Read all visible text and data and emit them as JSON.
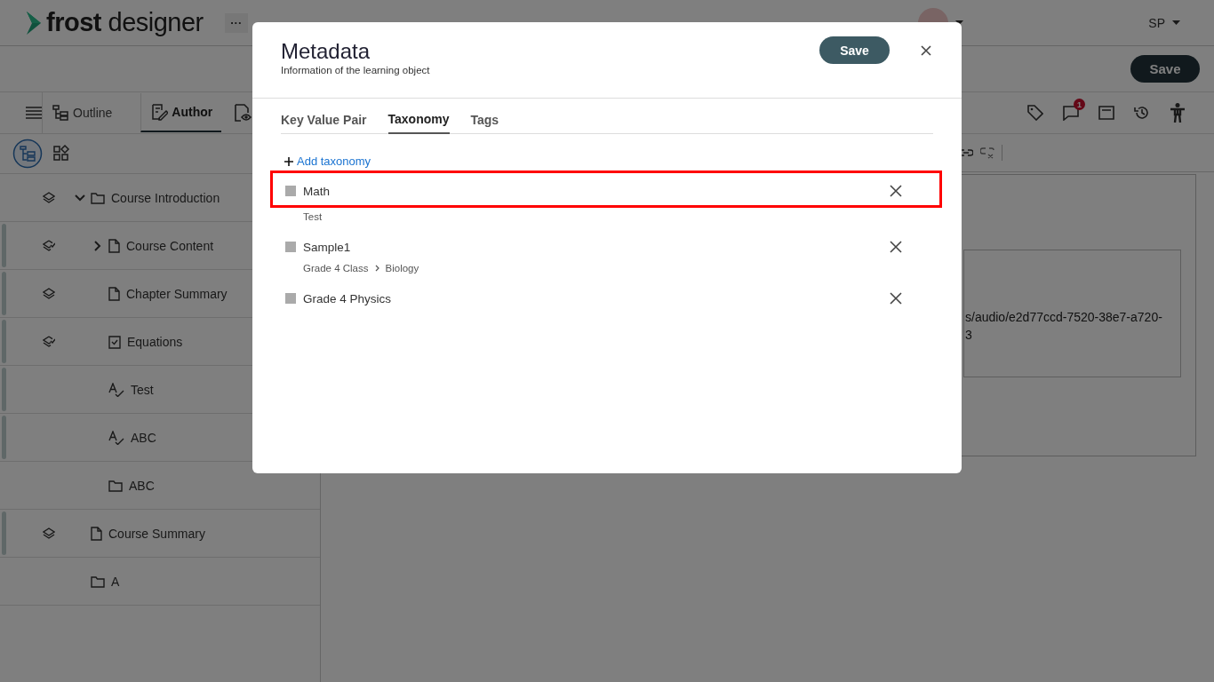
{
  "header": {
    "logo": "**frost** designer",
    "more": "···",
    "user": "SP"
  },
  "toolbar": {
    "save": "Save"
  },
  "view_tabs": [
    {
      "label": "Outline",
      "selected": false
    },
    {
      "label": "Author",
      "selected": true
    }
  ],
  "tree_modes": [
    {
      "kind": "tree",
      "selected": true
    },
    {
      "kind": "blocks",
      "selected": false
    }
  ],
  "tools": {
    "comment_badge": "1"
  },
  "tree": [
    {
      "label": "Course Introduction",
      "kind": "folder",
      "layered": true,
      "approved": false,
      "flagged": false,
      "expanded": true,
      "children": [
        {
          "label": "Course Content",
          "kind": "page",
          "layered": true,
          "approved": true,
          "flagged": true,
          "expanded": false
        },
        {
          "label": "Chapter Summary",
          "kind": "page",
          "layered": true,
          "approved": false,
          "flagged": true
        },
        {
          "label": "Equations",
          "kind": "checklist",
          "layered": true,
          "approved": true,
          "flagged": true
        },
        {
          "label": "Test",
          "kind": "assessment",
          "layered": false,
          "flagged": true
        },
        {
          "label": "ABC",
          "kind": "assessment",
          "layered": false,
          "flagged": true
        },
        {
          "label": "ABC",
          "kind": "folder",
          "layered": false,
          "flagged": false
        }
      ]
    },
    {
      "label": "Course Summary",
      "kind": "page",
      "layered": true,
      "approved": false,
      "flagged": true
    },
    {
      "label": "A",
      "kind": "folder",
      "layered": false,
      "flagged": false
    }
  ],
  "editor": {
    "url_lines": [
      "s/audio/e2d77ccd-7520-38e7-a720-",
      "3"
    ]
  },
  "dialog": {
    "title": "Metadata",
    "subtitle": "Information of the learning object",
    "save": "Save",
    "tabs": [
      {
        "label": "Key Value Pair",
        "selected": false
      },
      {
        "label": "Taxonomy",
        "selected": true
      },
      {
        "label": "Tags",
        "selected": false
      }
    ],
    "add": "Add taxonomy",
    "items": [
      {
        "name": "Math",
        "path": [
          "Test"
        ],
        "highlighted": true
      },
      {
        "name": "Sample1",
        "path": [
          "Grade 4 Class",
          "Biology"
        ],
        "highlighted": false
      },
      {
        "name": "Grade 4 Physics",
        "highlighted": false
      }
    ]
  }
}
